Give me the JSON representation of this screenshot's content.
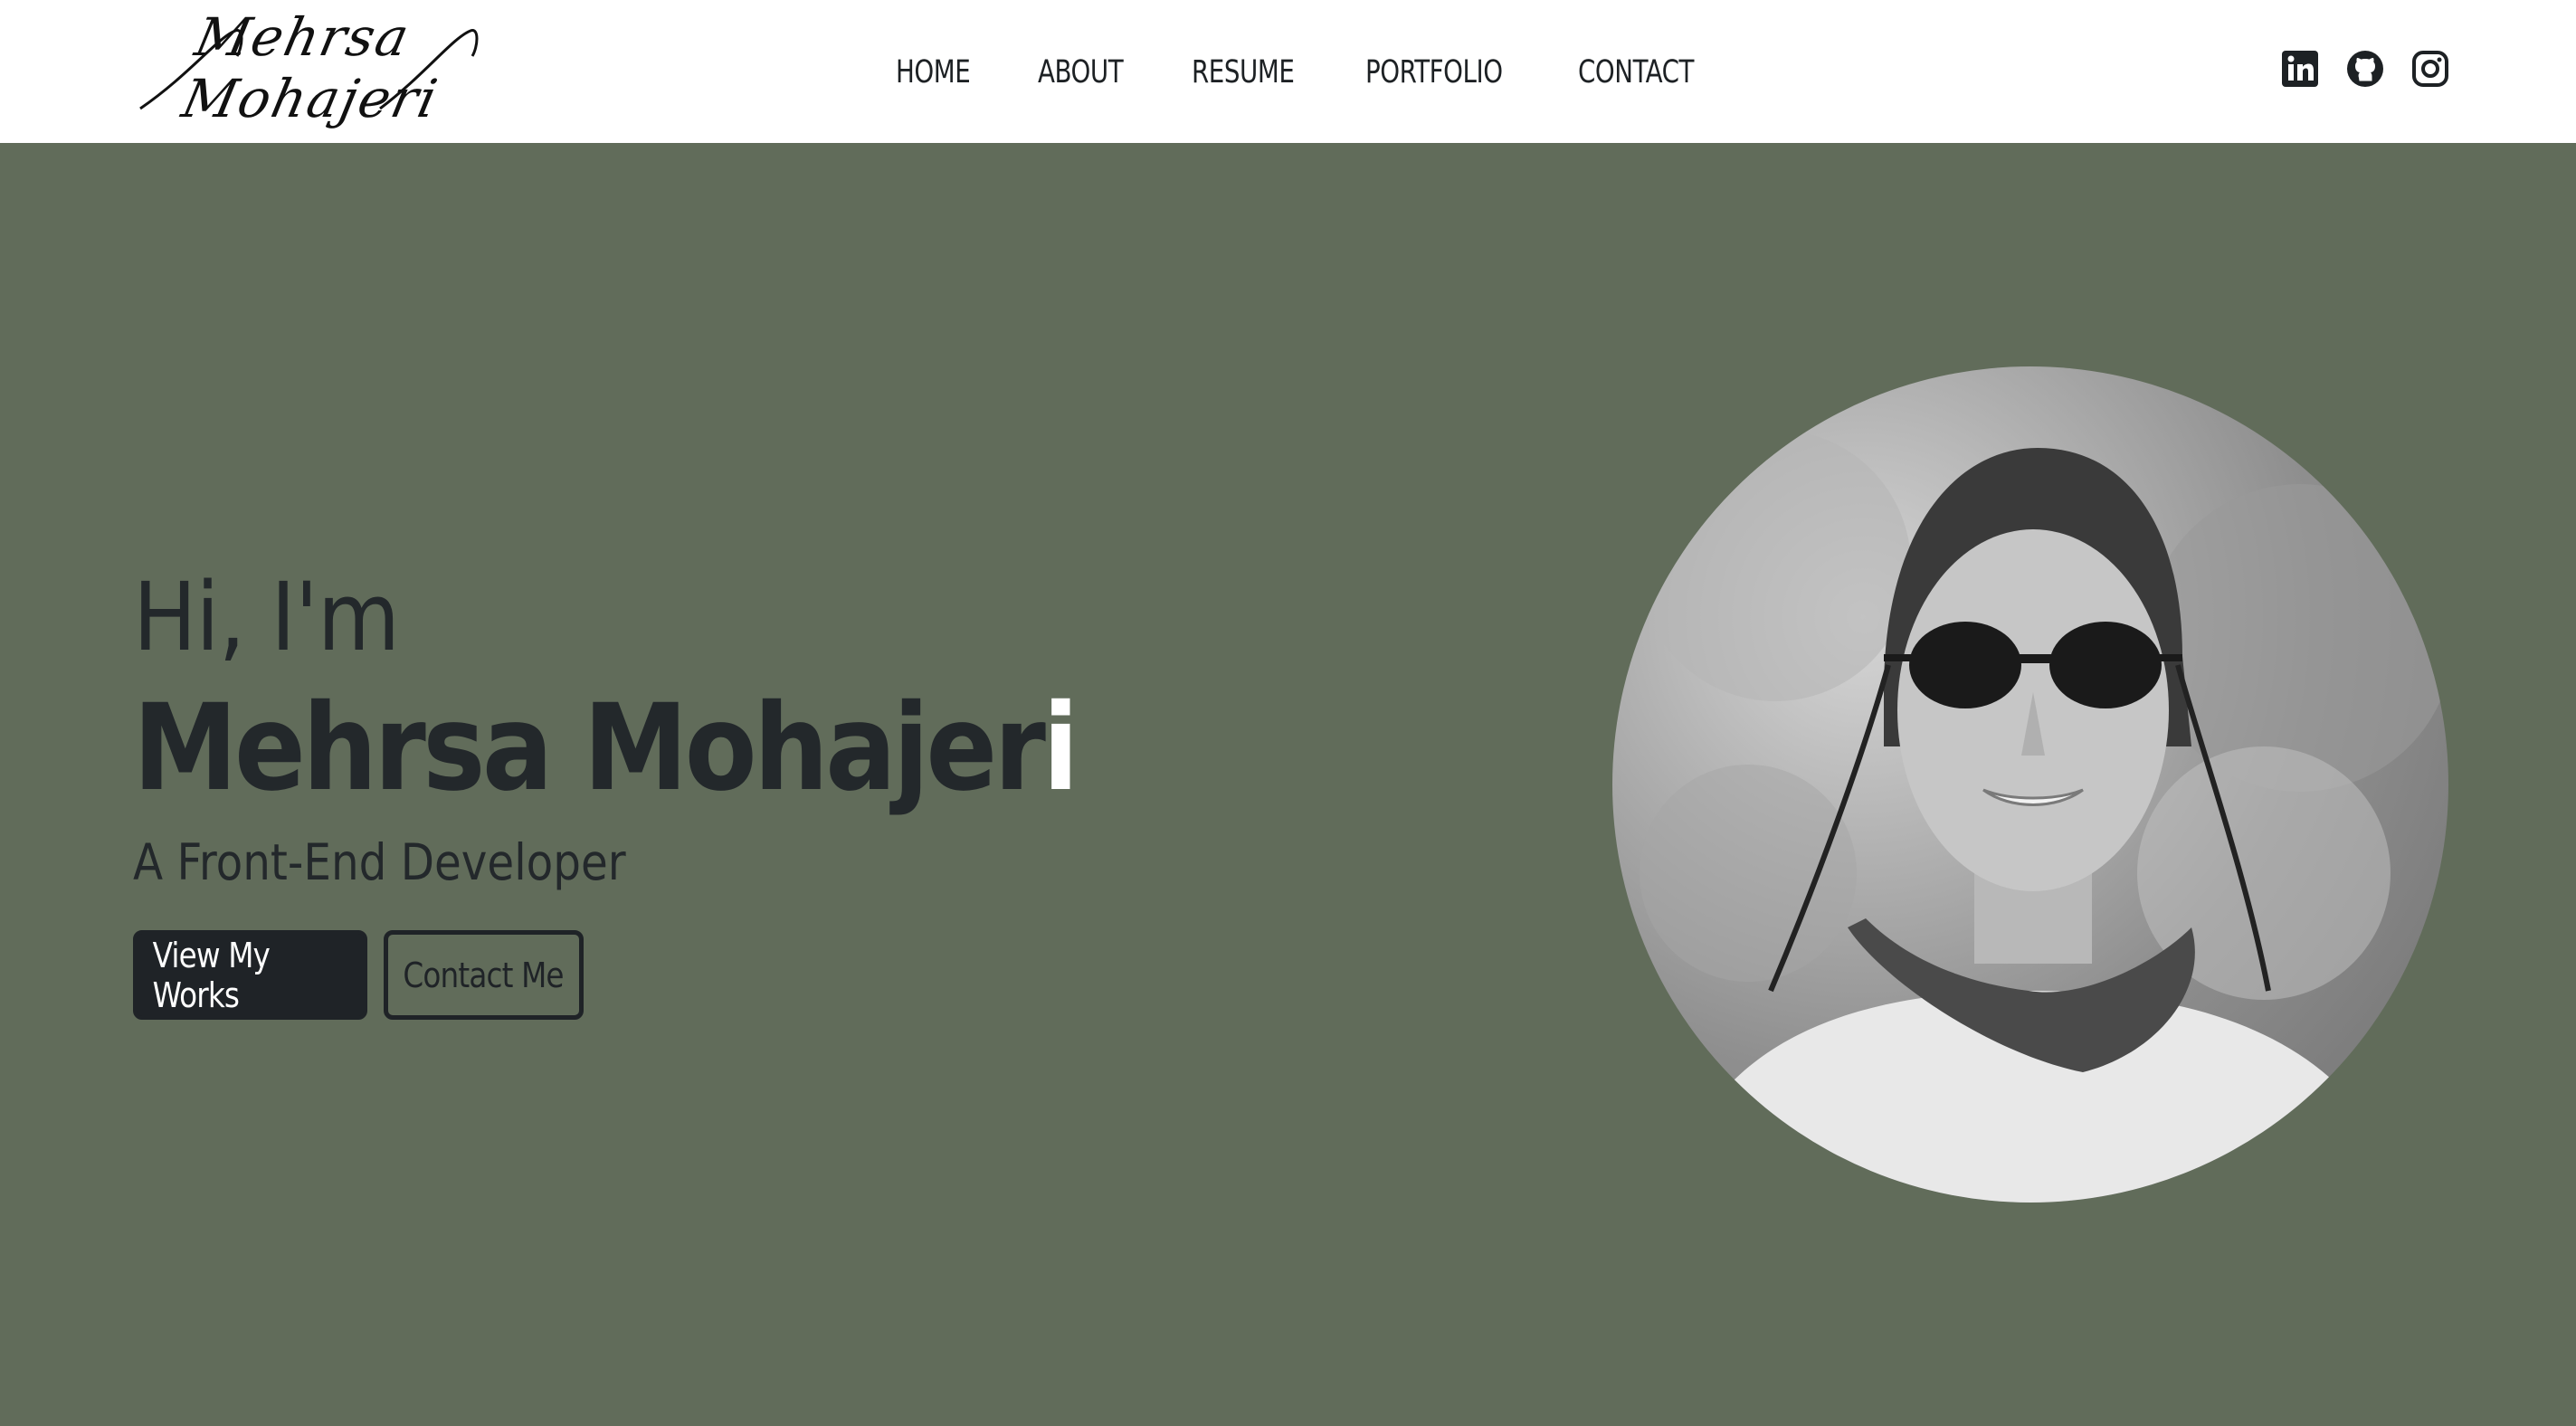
{
  "header": {
    "logo_text": "Mehrsa Mohajeri",
    "nav": [
      "HOME",
      "ABOUT",
      "RESUME",
      "PORTFOLIO",
      "CONTACT"
    ],
    "social_icons": [
      "linkedin-icon",
      "github-icon",
      "instagram-icon"
    ]
  },
  "hero": {
    "greeting": "Hi, I'm",
    "name_main": "Mehrsa Mohajer",
    "name_last_letter": "i",
    "role": "A Front-End Developer",
    "primary_button": "View My Works",
    "secondary_button": "Contact Me"
  },
  "colors": {
    "background": "#616c5a",
    "navbar": "#ffffff",
    "text_dark": "#23282b",
    "button_dark": "#1f2327"
  }
}
